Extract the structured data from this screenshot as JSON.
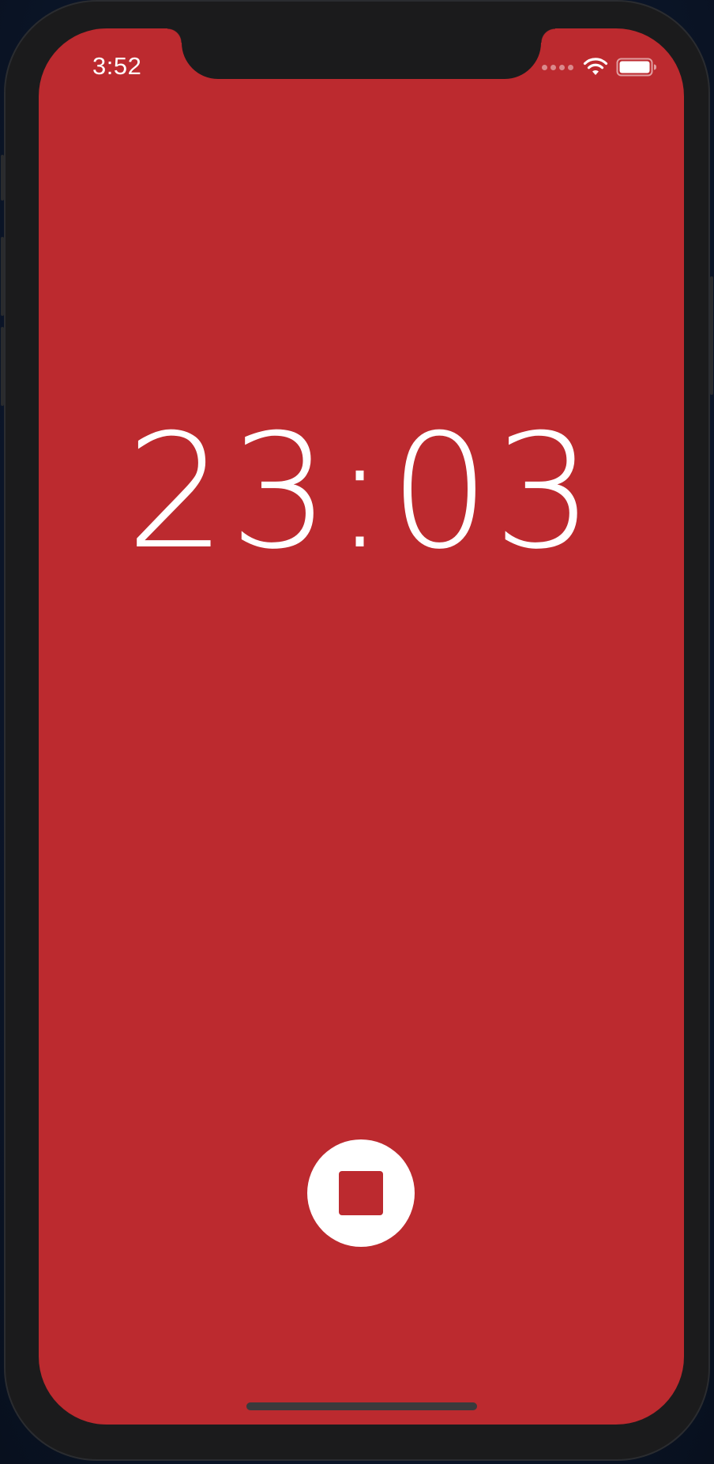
{
  "status_bar": {
    "time": "3:52",
    "cellular_icon": "cellular-dots-icon",
    "wifi_icon": "wifi-icon",
    "battery_icon": "battery-icon"
  },
  "timer": {
    "display": "23:03"
  },
  "controls": {
    "stop_icon": "stop-icon"
  },
  "colors": {
    "background": "#bc2a2f",
    "foreground": "#ffffff",
    "frame": "#1b1b1c"
  }
}
